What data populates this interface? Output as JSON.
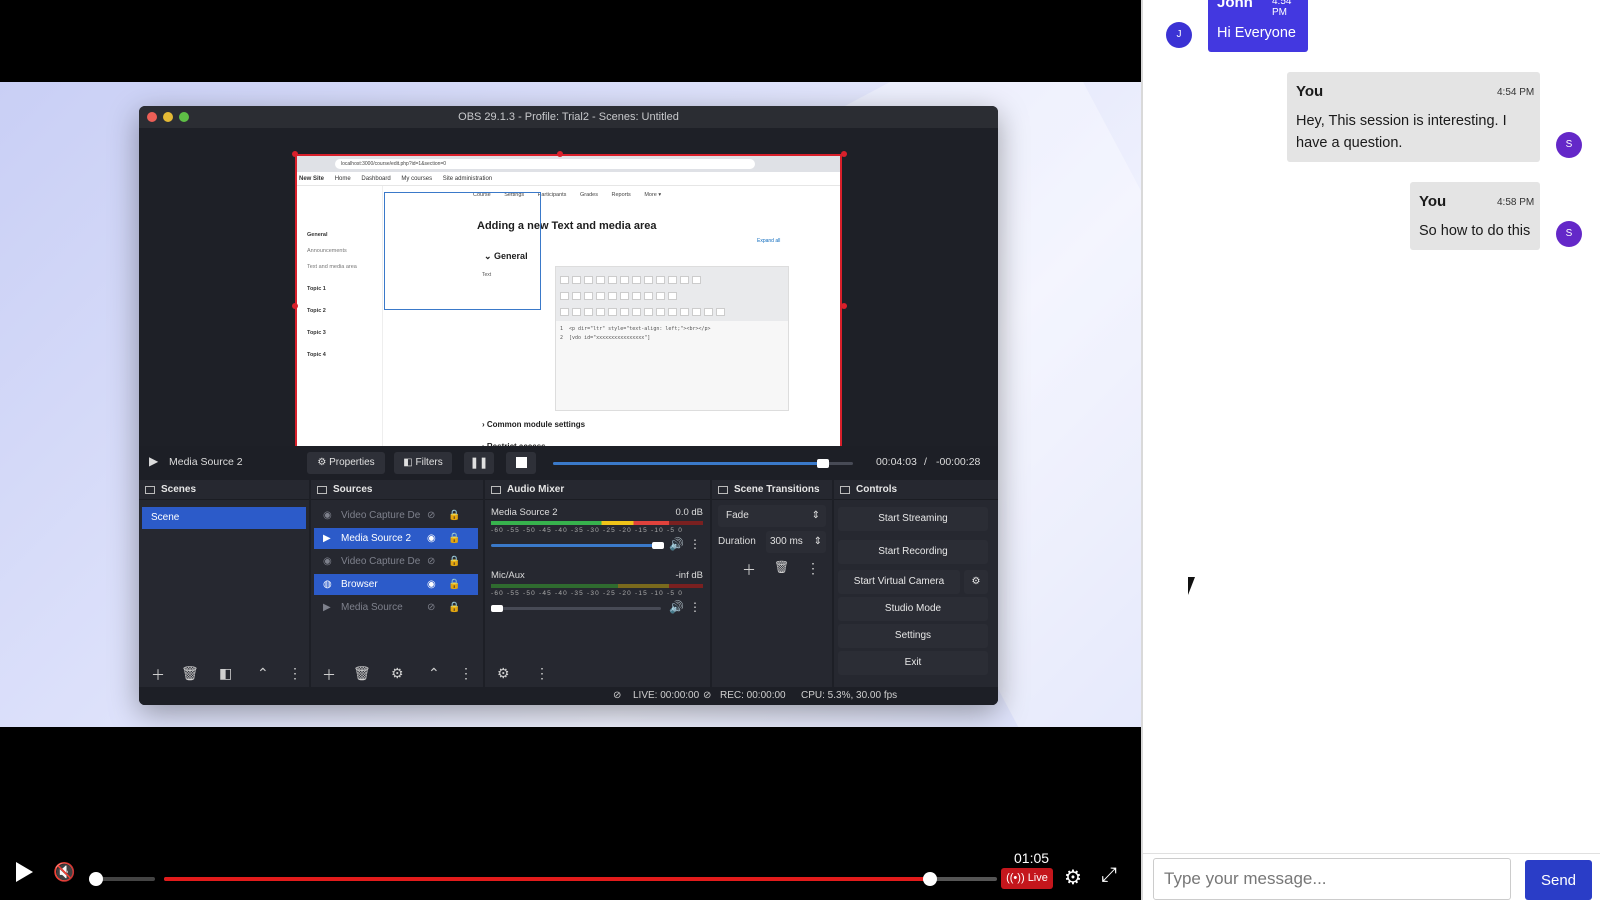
{
  "obs": {
    "window_title": "OBS 29.1.3 - Profile: Trial2 - Scenes: Untitled",
    "preview": {
      "url": "localhost:3000/course/edit.php?id=1&section=0",
      "site_name": "New Site",
      "nav": [
        "Home",
        "Dashboard",
        "My courses",
        "Site administration"
      ],
      "sidebar": [
        "General",
        "Announcements",
        "Text and media area",
        "Topic 1",
        "Topic 2",
        "Topic 3",
        "Topic 4"
      ],
      "tabs": [
        "Course",
        "Settings",
        "Participants",
        "Grades",
        "Reports",
        "More ▾"
      ],
      "heading": "Adding a new Text and media area",
      "expand_all": "Expand all",
      "section_general": "General",
      "field_text": "Text",
      "code": "1  <p dir=\"ltr\" style=\"text-align: left;\"><br></p>\n2  [vdo id=\"xxxxxxxxxxxxxxxx\"]",
      "section_cms": "Common module settings",
      "section_restrict": "Restrict access"
    },
    "transport": {
      "source_name": "Media Source 2",
      "properties_label": "Properties",
      "filters_label": "Filters",
      "elapsed": "00:04:03",
      "separator": "/",
      "remaining": "-00:00:28",
      "progress": 0.9
    },
    "docks": {
      "scenes_title": "Scenes",
      "sources_title": "Sources",
      "mixer_title": "Audio Mixer",
      "transitions_title": "Scene Transitions",
      "controls_title": "Controls"
    },
    "scenes": [
      "Scene"
    ],
    "sources": [
      {
        "label": "Video Capture De",
        "selected": false
      },
      {
        "label": "Media Source 2",
        "selected": true
      },
      {
        "label": "Video Capture De",
        "selected": false
      },
      {
        "label": "Browser",
        "selected": true
      },
      {
        "label": "Media Source",
        "selected": false
      }
    ],
    "mixer": [
      {
        "name": "Media Source 2",
        "level": "0.0 dB",
        "volume": 0.95
      },
      {
        "name": "Mic/Aux",
        "level": "-inf dB",
        "volume": 0.05
      }
    ],
    "mixer_ticks": "-60 -55 -50 -45 -40 -35 -30 -25 -20 -15 -10 -5 0",
    "transitions": {
      "type": "Fade",
      "duration_label": "Duration",
      "duration_value": "300 ms"
    },
    "controls": {
      "start_streaming": "Start Streaming",
      "start_recording": "Start Recording",
      "start_virtual_camera": "Start Virtual Camera",
      "studio_mode": "Studio Mode",
      "settings": "Settings",
      "exit": "Exit"
    },
    "status": {
      "live": "LIVE: 00:00:00",
      "rec": "REC: 00:00:00",
      "cpu": "CPU: 5.3%, 30.00 fps"
    }
  },
  "player": {
    "time": "01:05",
    "live_label": "Live",
    "volume": 0.0,
    "progress": 0.92
  },
  "chat": {
    "messages": [
      {
        "avatar": "J",
        "name": "John",
        "time": "4:54 PM",
        "text": "Hi Everyone"
      },
      {
        "avatar": "S",
        "name": "You",
        "time": "4:54 PM",
        "text": "Hey, This session is interesting. I have a question."
      },
      {
        "avatar": "S",
        "name": "You",
        "time": "4:58 PM",
        "text": "So how to do this"
      }
    ],
    "input_placeholder": "Type your message...",
    "send_label": "Send"
  },
  "colors": {
    "accent": "#2a3dc7",
    "live_red": "#c4161c",
    "obs_selection": "#2c5bc9",
    "avatar": "#6428c8"
  }
}
